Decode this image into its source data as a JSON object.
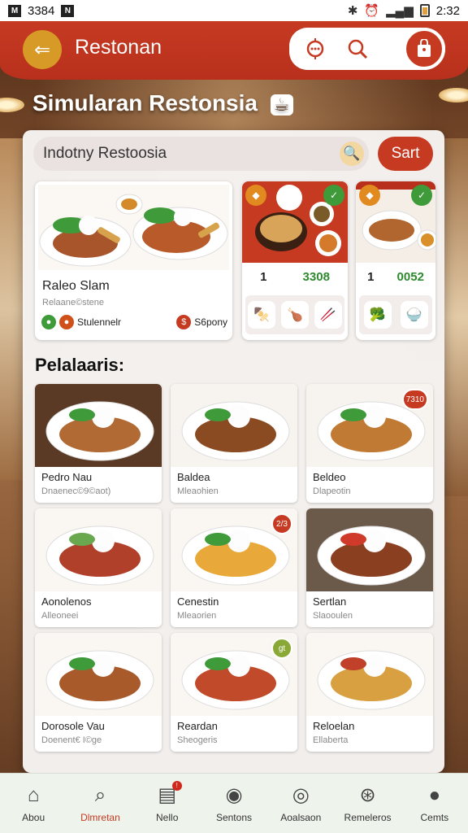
{
  "status": {
    "time": "2:32",
    "left_text": "3384",
    "left_badge_1": "M",
    "left_badge_2": "N"
  },
  "appbar": {
    "title": "Restonan"
  },
  "headline": "Simularan Restonsia",
  "search": {
    "value": "Indotny Restoosia",
    "button_label": "Sart"
  },
  "featured": {
    "title": "Raleo Slam",
    "subtitle": "Relaane©stene",
    "meta_left": "Stulennelr",
    "meta_right": "S6pony"
  },
  "promos": [
    {
      "qty": "1",
      "price": "3308"
    },
    {
      "qty": "1",
      "price": "0052"
    }
  ],
  "section_title": "Pelalaaris:",
  "menu": [
    {
      "name": "Pedro Nau",
      "sub": "Dnaenec©9©aot)",
      "tag": ""
    },
    {
      "name": "Baldea",
      "sub": "Mleaohien",
      "tag": ""
    },
    {
      "name": "Beldeo",
      "sub": "Dlapeotin",
      "tag": "7310"
    },
    {
      "name": "Aonolenos",
      "sub": "Alleoneei",
      "tag": ""
    },
    {
      "name": "Cenestin",
      "sub": "Mleaorien",
      "tag": "2/3"
    },
    {
      "name": "Sertlan",
      "sub": "Slaooulen",
      "tag": ""
    },
    {
      "name": "Dorosole Vau",
      "sub": "Doenent€ I©ge",
      "tag": ""
    },
    {
      "name": "Reardan",
      "sub": "Sheogeris",
      "tag": "gt"
    },
    {
      "name": "Reloelan",
      "sub": "Ellaberta",
      "tag": ""
    }
  ],
  "nav": [
    {
      "label": "Abou",
      "icon": "home-icon"
    },
    {
      "label": "Dlmretan",
      "icon": "search-icon",
      "active": true
    },
    {
      "label": "Nello",
      "icon": "news-icon",
      "badge": "!"
    },
    {
      "label": "Sentons",
      "icon": "apple-icon"
    },
    {
      "label": "Aoalsaon",
      "icon": "dish-icon"
    },
    {
      "label": "Remeleros",
      "icon": "globe-icon"
    },
    {
      "label": "Cemts",
      "icon": "person-icon"
    }
  ],
  "colors": {
    "primary": "#c63a22",
    "accent": "#d79a27",
    "nav_bg": "#eef3ec"
  }
}
